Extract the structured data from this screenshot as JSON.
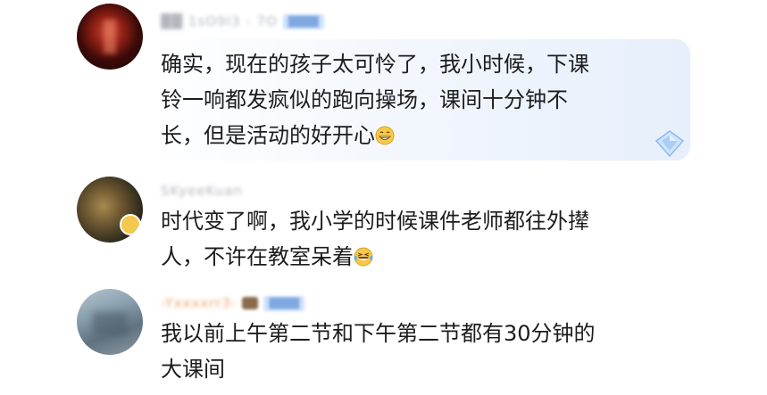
{
  "comments": [
    {
      "username": "██ 1sO9I3 - 7O",
      "tag": "████",
      "lines": [
        "确实，现在的孩子太可怜了，我小时候，下课",
        "铃一响都发疯似的跑向操场，课间十分钟不",
        "长，但是活动的好开心"
      ],
      "emoji": "grinning-face-icon"
    },
    {
      "username": "SKyeeKuan",
      "lines": [
        "时代变了啊，我小学的时候课件老师都往外撵",
        "人，不许在教室呆着"
      ],
      "emoji": "laughing-tears-face-icon"
    },
    {
      "username": "-Yxxxxrr3-",
      "tag": "████",
      "lines": [
        "我以前上午第二节和下午第二节都有30分钟的",
        "大课间"
      ]
    }
  ],
  "colors": {
    "text": "#1c1c1e",
    "username": "#b3b7bd",
    "username_highlight": "#f0a56a",
    "tag_background": "#cfe2fb",
    "bubble_tint": "#e6effb"
  }
}
